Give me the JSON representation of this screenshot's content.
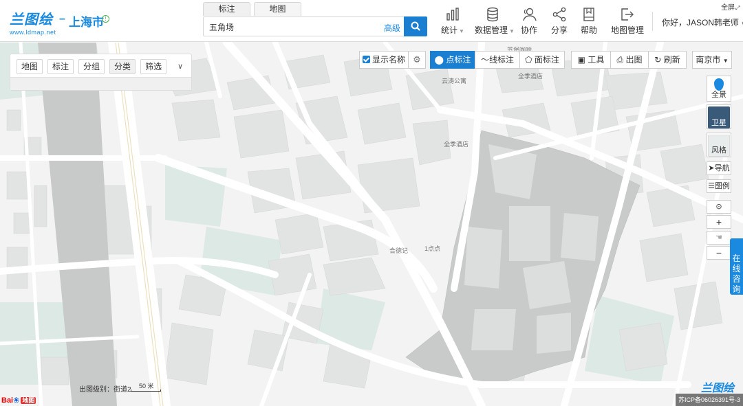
{
  "header": {
    "logo_text": "兰图绘",
    "logo_url": "www.ldmap.net",
    "city_separator": "–",
    "city": "上海市",
    "search_tabs": [
      "标注",
      "地图"
    ],
    "search_value": "五角场",
    "advanced_label": "高级",
    "nav": [
      {
        "label": "统计",
        "icon": "bar-chart-icon",
        "caret": true
      },
      {
        "label": "数据管理",
        "icon": "database-icon",
        "caret": true
      },
      {
        "label": "协作",
        "icon": "users-icon",
        "caret": false
      },
      {
        "label": "分享",
        "icon": "share-icon",
        "caret": false
      },
      {
        "label": "帮助",
        "icon": "book-icon",
        "caret": false
      },
      {
        "label": "地图管理",
        "icon": "exit-icon",
        "caret": false
      }
    ],
    "user_greeting": "你好，JASON韩老师",
    "fullscreen_label": "全屏"
  },
  "left_panel": {
    "tabs": [
      "地图",
      "标注",
      "分组",
      "分类",
      "筛选"
    ],
    "active_tab": "分类"
  },
  "toolbar": {
    "show_names_label": "显示名称",
    "point_label": "点标注",
    "line_label": "线标注",
    "area_label": "面标注",
    "tools_label": "工具",
    "print_label": "出图",
    "refresh_label": "刷新",
    "city_select": "南京市"
  },
  "right_controls": {
    "panorama": "全景",
    "satellite": "卫星",
    "style": "风格",
    "navigation": "导航",
    "legend": "图例",
    "consult": "在线咨询"
  },
  "map_labels": [
    "蓝堡咖啡",
    "全季酒店",
    "云涛公寓",
    "全季酒店",
    "合德记",
    "1点点"
  ],
  "scale": {
    "level_label": "出图级别：",
    "level_value": "街道2",
    "scale_text": "50 米"
  },
  "footer": {
    "baidu_text": "Bai",
    "baidu_map": "地图",
    "brand": "兰图绘",
    "icp": "苏ICP备06026391号-3"
  },
  "colors": {
    "accent": "#1a7fd1",
    "brand": "#1a8ae0",
    "map_bg": "#f3f3f3",
    "building": "#e0e3e3",
    "green": "#dce9e4"
  }
}
